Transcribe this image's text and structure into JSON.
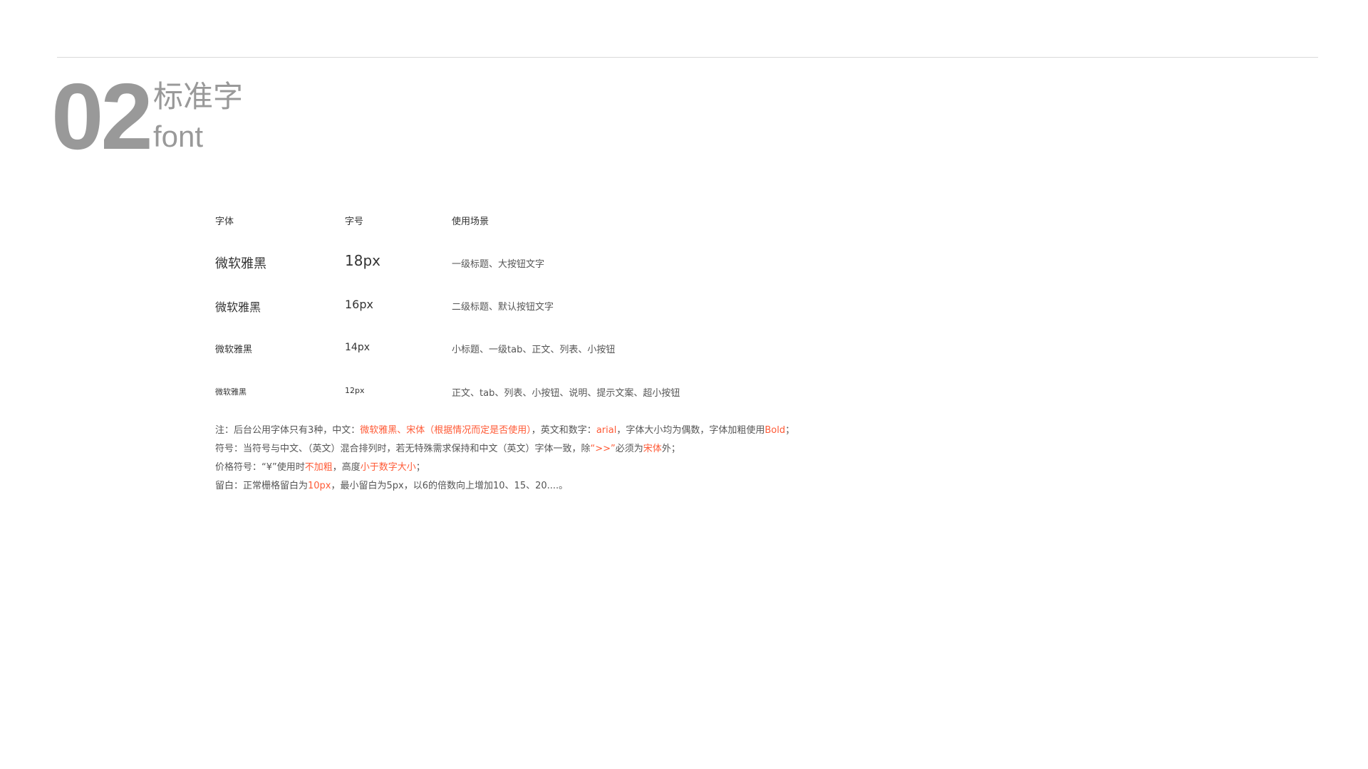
{
  "header": {
    "number": "02",
    "title_cn": "标准字",
    "title_en": "font"
  },
  "table": {
    "columns": [
      "字体",
      "字号",
      "使用场景"
    ],
    "rows": [
      {
        "font": "微软雅黑",
        "size": "18px",
        "usage": "一级标题、大按钮文字"
      },
      {
        "font": "微软雅黑",
        "size": "16px",
        "usage": "二级标题、默认按钮文字"
      },
      {
        "font": "微软雅黑",
        "size": "14px",
        "usage": "小标题、一级tab、正文、列表、小按钮"
      },
      {
        "font": "微软雅黑",
        "size": "12px",
        "usage": "正文、tab、列表、小按钮、说明、提示文案、超小按钮"
      }
    ]
  },
  "notes": {
    "line1": {
      "a": "注：后台公用字体只有3种，中文：",
      "b": "微软雅黑、宋体（根据情况而定是否使用）",
      "c": "，英文和数字：",
      "d": "arial",
      "e": "，字体大小均为偶数，字体加粗使用",
      "f": "Bold",
      "g": "；"
    },
    "line2": {
      "a": "符号：当符号与中文、（英文）混合排列时，若无特殊需求保持和中文（英文）字体一致，除",
      "b": "“>>”",
      "c": "必须为",
      "d": "宋体",
      "e": "外；"
    },
    "line3": {
      "a": "价格符号：“¥”使用时",
      "b": "不加粗",
      "c": "，高度",
      "d": "小于数字大小",
      "e": "；"
    },
    "line4": {
      "a": "留白：正常栅格留白为",
      "b": "10px",
      "c": "，最小留白为5px，以6的倍数向上增加10、15、20....。"
    }
  },
  "colors": {
    "accent": "#ff5a36",
    "heading_gray": "#999999",
    "rule": "#d9d9d9"
  }
}
